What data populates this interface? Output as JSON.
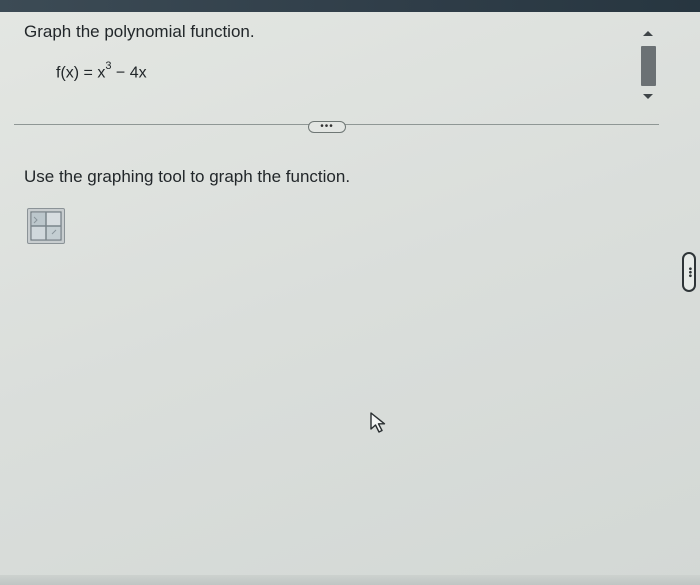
{
  "question": {
    "title": "Graph the polynomial function.",
    "formula_prefix": "f(x) = x",
    "formula_exponent": "3",
    "formula_suffix": " − 4x"
  },
  "expander": {
    "label": "•••"
  },
  "instruction": {
    "text": "Use the graphing tool to graph the function."
  },
  "graph_tool": {
    "icon": "graph-tool-icon"
  },
  "scrollbar": {
    "up_icon": "triangle-up-icon",
    "down_icon": "triangle-down-icon"
  },
  "side_handle": {
    "label": "•••"
  },
  "colors": {
    "top_strip": "#2f3d48",
    "panel_background": "#dadedb",
    "text": "#22272a",
    "divider": "#8f9795"
  }
}
